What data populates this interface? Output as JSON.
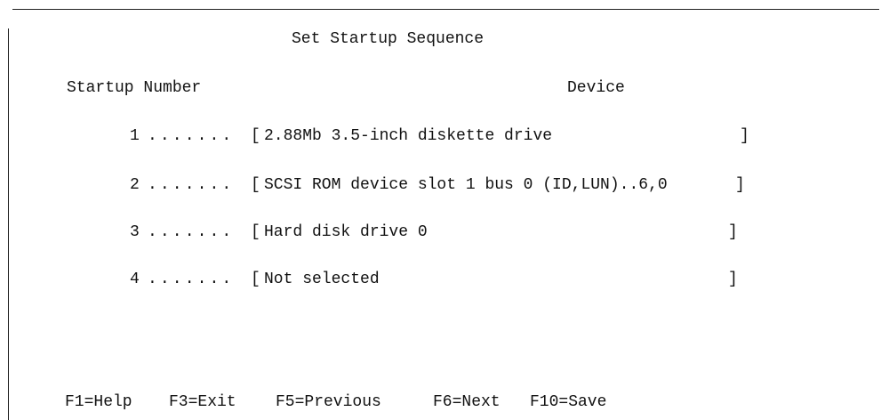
{
  "screen": {
    "title": "Set Startup Sequence",
    "column_headers": {
      "startup_number": "Startup Number",
      "device": "Device"
    }
  },
  "startup_rows": [
    {
      "number": "1",
      "dots": ".......",
      "device": "2.88Mb 3.5-inch diskette drive"
    },
    {
      "number": "2",
      "dots": ".......",
      "device": "SCSI ROM device slot 1 bus 0 (ID,LUN)..6,0"
    },
    {
      "number": "3",
      "dots": ".......",
      "device": "Hard disk drive 0"
    },
    {
      "number": "4",
      "dots": ".......",
      "device": "Not selected"
    }
  ],
  "bracket_open": "[",
  "bracket_close": "]",
  "function_keys": [
    {
      "label": "F1=Help"
    },
    {
      "label": "F3=Exit"
    },
    {
      "label": "F5=Previous"
    },
    {
      "label": "F6=Next"
    },
    {
      "label": "F10=Save"
    }
  ]
}
